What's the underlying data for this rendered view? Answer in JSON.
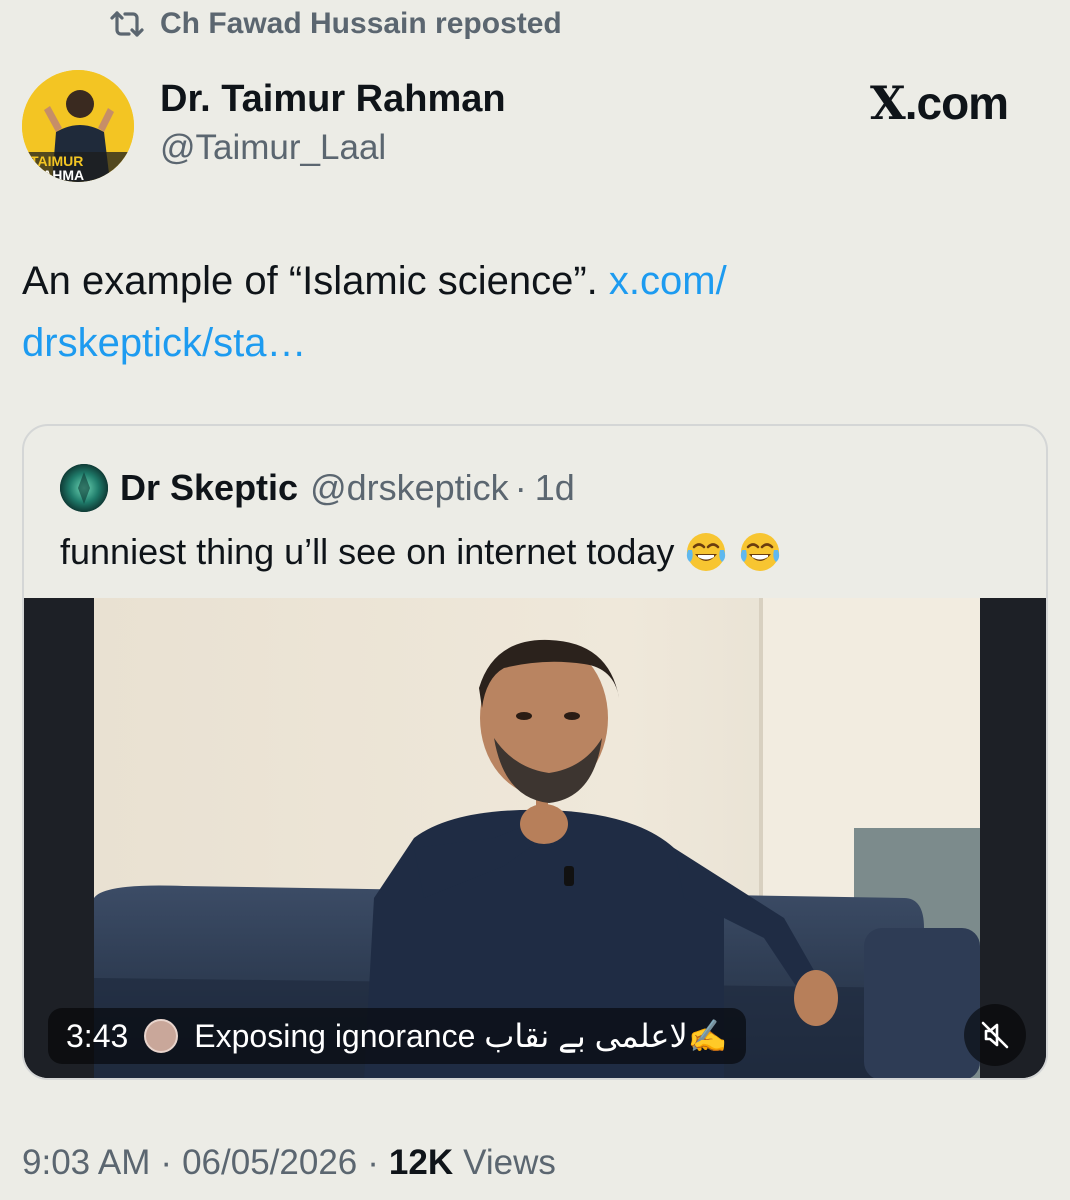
{
  "repost": {
    "icon": "repost-icon",
    "text": "Ch Fawad Hussain reposted"
  },
  "author": {
    "name": "Dr. Taimur Rahman",
    "handle": "@Taimur_Laal",
    "avatar_text": "TAIMUR RAHMAN",
    "avatar_color": "#f3c523"
  },
  "brand": {
    "logo_letter": "X",
    "logo_rest": ".com"
  },
  "tweet": {
    "text": "An example of “Islamic science”.",
    "link_line1": "x.com/",
    "link_line2": "drskeptick/sta…",
    "link_color": "#1d9bf0"
  },
  "quote": {
    "name": "Dr Skeptic",
    "handle": "@drskeptick",
    "dot": "·",
    "time": "1d",
    "text": "funniest thing u’ll see on internet today",
    "emojis": [
      "face-with-tears-of-joy-icon",
      "face-with-tears-of-joy-icon"
    ],
    "video": {
      "duration": "3:43",
      "caption": "Exposing ignorance لاعلمی بے نقاب✍️",
      "mute_icon": "mute-icon"
    }
  },
  "footer": {
    "time": "9:03 AM",
    "date": "06/05/2026",
    "views_count": "12K",
    "views_label": "Views",
    "sep": "·"
  }
}
